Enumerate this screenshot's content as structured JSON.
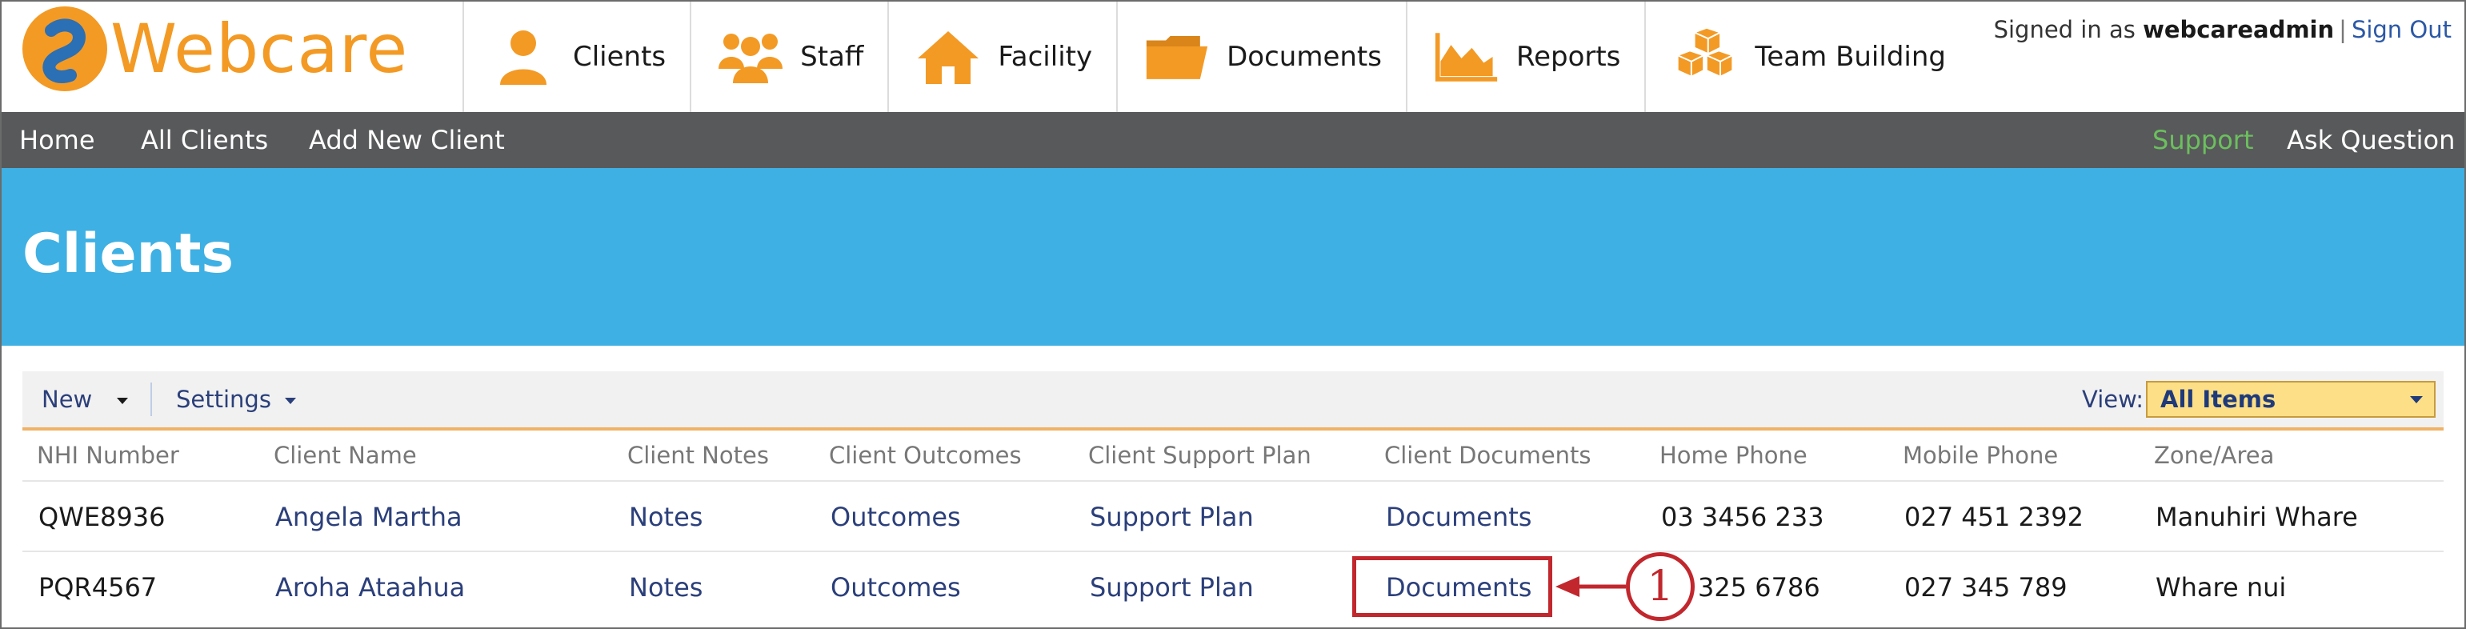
{
  "app": {
    "logo_text": "Webcare"
  },
  "nav": [
    {
      "label": "Clients",
      "icon": "person-icon"
    },
    {
      "label": "Staff",
      "icon": "group-icon"
    },
    {
      "label": "Facility",
      "icon": "house-icon"
    },
    {
      "label": "Documents",
      "icon": "folder-icon"
    },
    {
      "label": "Reports",
      "icon": "chart-icon"
    },
    {
      "label": "Team Building",
      "icon": "blocks-icon"
    }
  ],
  "session": {
    "prefix": "Signed in as",
    "user": "webcareadmin",
    "separator": "|",
    "signout": "Sign Out"
  },
  "menubar": {
    "home": "Home",
    "all_clients": "All Clients",
    "add_client": "Add New Client",
    "support": "Support",
    "ask": "Ask Question"
  },
  "page": {
    "title": "Clients"
  },
  "toolbar": {
    "new_label": "New",
    "settings_label": "Settings",
    "view_label": "View:",
    "view_value": "All Items"
  },
  "table": {
    "headers": [
      "NHI Number",
      "Client Name",
      "Client Notes",
      "Client Outcomes",
      "Client Support Plan",
      "Client Documents",
      "Home Phone",
      "Mobile Phone",
      "Zone/Area"
    ],
    "rows": [
      [
        "QWE8936",
        "Angela Martha",
        "Notes",
        "Outcomes",
        "Support Plan",
        "Documents",
        "03 3456 233",
        "027 451 2392",
        "Manuhiri Whare"
      ],
      [
        "PQR4567",
        "Aroha Ataahua",
        "Notes",
        "Outcomes",
        "Support Plan",
        "Documents",
        "325 6786",
        "027 345 789",
        "Whare nui"
      ]
    ]
  },
  "annotation": {
    "number": "1"
  },
  "colors": {
    "orange": "#f39a25",
    "menubar": "#58595b",
    "banner": "#3eb0e3",
    "link": "#2b3f7a",
    "support": "#6cbf5e",
    "callout": "#c1272d"
  }
}
